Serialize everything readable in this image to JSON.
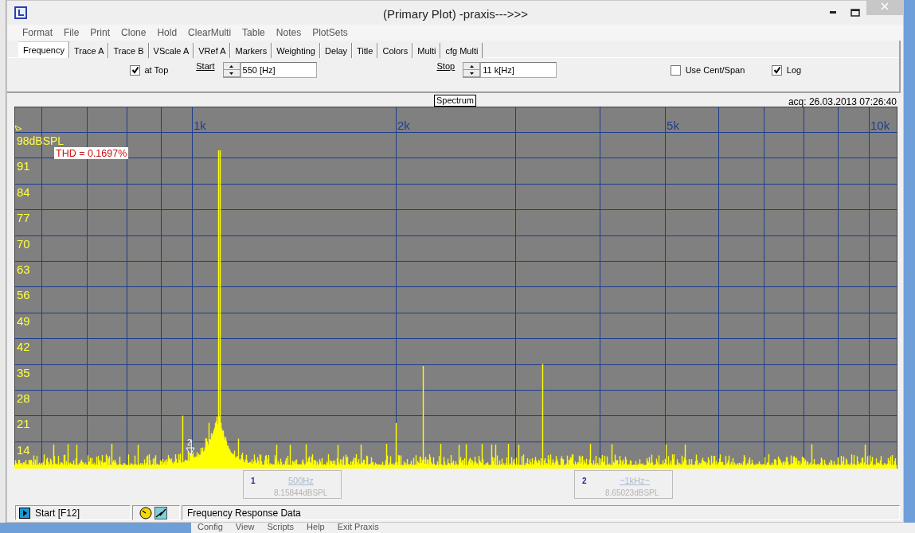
{
  "window": {
    "title": "(Primary Plot) -praxis--->>>"
  },
  "menu": [
    "Format",
    "File",
    "Print",
    "Clone",
    "Hold",
    "ClearMulti",
    "Table",
    "Notes",
    "PlotSets"
  ],
  "tabs": [
    {
      "label": "Frequency",
      "selected": true
    },
    {
      "label": "Trace A",
      "selected": false
    },
    {
      "label": "Trace B",
      "selected": false
    },
    {
      "label": "VScale A",
      "selected": false
    },
    {
      "label": "VRef A",
      "selected": false
    },
    {
      "label": "Markers",
      "selected": false
    },
    {
      "label": "Weighting",
      "selected": false
    },
    {
      "label": "Delay",
      "selected": false
    },
    {
      "label": "Title",
      "selected": false
    },
    {
      "label": "Colors",
      "selected": false
    },
    {
      "label": "Multi",
      "selected": false
    },
    {
      "label": "cfg Multi",
      "selected": false
    }
  ],
  "controls": {
    "at_top": {
      "label": "at Top",
      "checked": true
    },
    "start": {
      "label": "Start",
      "value": "550 [Hz]"
    },
    "stop": {
      "label": "Stop",
      "value": "11 k[Hz]"
    },
    "use_cent_span": {
      "label": "Use Cent/Span",
      "checked": false
    },
    "log": {
      "label": "Log",
      "checked": true
    }
  },
  "plot": {
    "title": "Spectrum",
    "acquired": "acq: 26.03.2013 07:26:40",
    "y_top_label": "98dBSPL",
    "y_labels": [
      "91",
      "84",
      "77",
      "70",
      "63",
      "56",
      "49",
      "42",
      "35",
      "28",
      "21",
      "14"
    ],
    "x_labels": [
      "1k",
      "2k",
      "5k",
      "10k"
    ],
    "thd": "THD = 0.1697%",
    "marker_label": "2"
  },
  "markers": [
    {
      "number": "1",
      "frequency": "500Hz",
      "reading": "8.15844dBSPL"
    },
    {
      "number": "2",
      "frequency": "~1kHz~",
      "reading": "8.65023dBSPL"
    }
  ],
  "status_bar": {
    "start": "Start [F12]",
    "message": "Frequency Response Data"
  },
  "background_menu": [
    "Config",
    "View",
    "Scripts",
    "Help",
    "Exit Praxis"
  ]
}
